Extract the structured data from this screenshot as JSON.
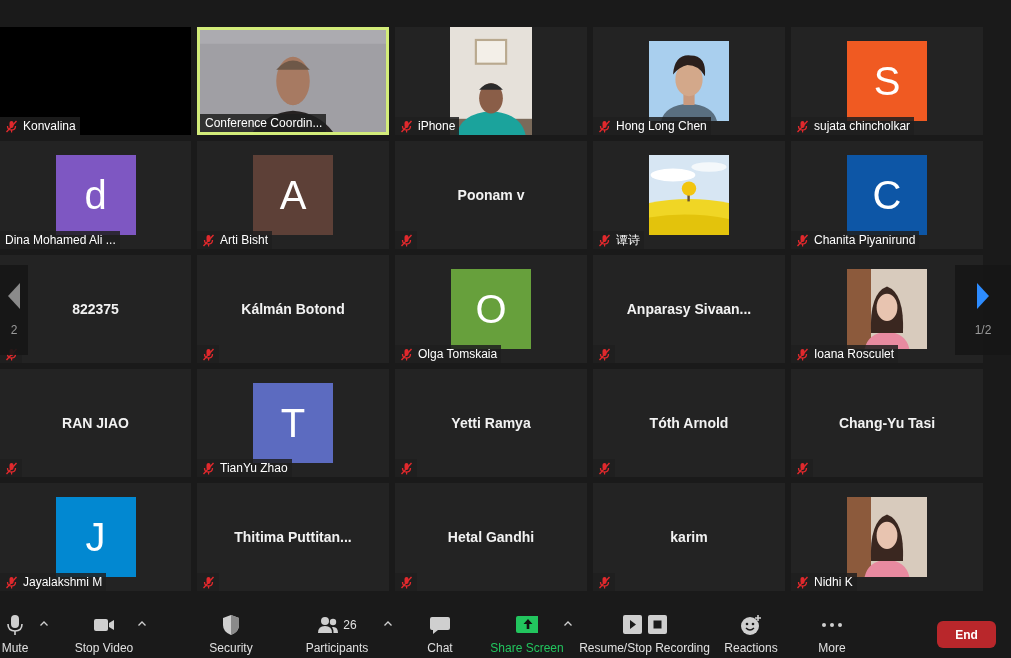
{
  "tiles": [
    {
      "kind": "blank_video",
      "name": "Konvalina",
      "muted": true,
      "speaking": false
    },
    {
      "kind": "video",
      "name": "Conference Coordin...",
      "muted": false,
      "speaking": true
    },
    {
      "kind": "portrait_video",
      "name": "iPhone",
      "muted": true,
      "speaking": false
    },
    {
      "name": "Hong Long Chen",
      "muted": true,
      "speaking": false
    },
    {
      "kind": "avatar",
      "letter": "S",
      "color": "#f05a22",
      "name": "sujata chincholkar",
      "muted": true,
      "speaking": false
    },
    {
      "kind": "avatar",
      "letter": "d",
      "color": "#7e57c2",
      "name": "Dina Mohamed Ali ...",
      "muted": false,
      "speaking": false
    },
    {
      "kind": "avatar",
      "letter": "A",
      "color": "#5d4037",
      "name": "Arti Bisht",
      "muted": true,
      "speaking": false
    },
    {
      "kind": "name",
      "name": "Poonam v",
      "muted": true,
      "speaking": false
    },
    {
      "name": "谭诗",
      "muted": true,
      "speaking": false
    },
    {
      "kind": "avatar",
      "letter": "C",
      "color": "#0d56a6",
      "name": "Chanita Piyanirund",
      "muted": true,
      "speaking": false
    },
    {
      "kind": "name",
      "name": "822375",
      "muted": true,
      "speaking": false
    },
    {
      "kind": "name",
      "name": "Kálmán Botond",
      "muted": true,
      "speaking": false
    },
    {
      "kind": "avatar",
      "letter": "O",
      "color": "#67a03c",
      "name": "Olga Tomskaia",
      "muted": true,
      "speaking": false
    },
    {
      "kind": "name",
      "name": "Anparasy  Sivaan...",
      "muted": true,
      "speaking": false
    },
    {
      "name": "Ioana Rosculet",
      "muted": true,
      "speaking": false
    },
    {
      "kind": "name",
      "name": "RAN JIAO",
      "muted": true,
      "speaking": false
    },
    {
      "kind": "avatar",
      "letter": "T",
      "color": "#5c6bc0",
      "name": "TianYu Zhao",
      "muted": true,
      "speaking": false
    },
    {
      "kind": "name",
      "name": "Yetti Ramya",
      "muted": true,
      "speaking": false
    },
    {
      "kind": "name",
      "name": "Tóth Arnold",
      "muted": true,
      "speaking": false
    },
    {
      "kind": "name",
      "name": "Chang-Yu Tasi",
      "muted": true,
      "speaking": false
    },
    {
      "kind": "avatar",
      "letter": "J",
      "color": "#0288d1",
      "name": "Jayalakshmi M",
      "muted": true,
      "speaking": false
    },
    {
      "kind": "name",
      "name": "Thitima  Puttitan...",
      "muted": true,
      "speaking": false
    },
    {
      "kind": "name",
      "name": "Hetal Gandhi",
      "muted": true,
      "speaking": false
    },
    {
      "kind": "name",
      "name": "karim",
      "muted": true,
      "speaking": false
    },
    {
      "name": "Nidhi K",
      "muted": true,
      "speaking": false
    }
  ],
  "pager": {
    "previous": {
      "label": "2",
      "disabled": true
    },
    "next": {
      "label": "1/2",
      "disabled": false
    }
  },
  "toolbar": [
    {
      "kind": "mic",
      "label": "Mute",
      "caret": true,
      "accent": false
    },
    {
      "kind": "camera",
      "label": "Stop Video",
      "caret": true,
      "accent": false
    },
    {
      "kind": "shield",
      "label": "Security",
      "caret": false,
      "accent": false
    },
    {
      "kind": "people",
      "label": "Participants",
      "count": "26",
      "caret": true,
      "accent": false
    },
    {
      "kind": "chat",
      "label": "Chat",
      "caret": false,
      "accent": false
    },
    {
      "kind": "share",
      "label": "Share Screen",
      "caret": true,
      "accent": true
    },
    {
      "kind": "record",
      "label": "Resume/Stop Recording",
      "caret": false,
      "accent": false
    },
    {
      "kind": "reactions",
      "label": "Reactions",
      "caret": false,
      "accent": false
    },
    {
      "kind": "more",
      "label": "More",
      "caret": false,
      "accent": false
    }
  ],
  "end_button": {
    "label": "End"
  }
}
